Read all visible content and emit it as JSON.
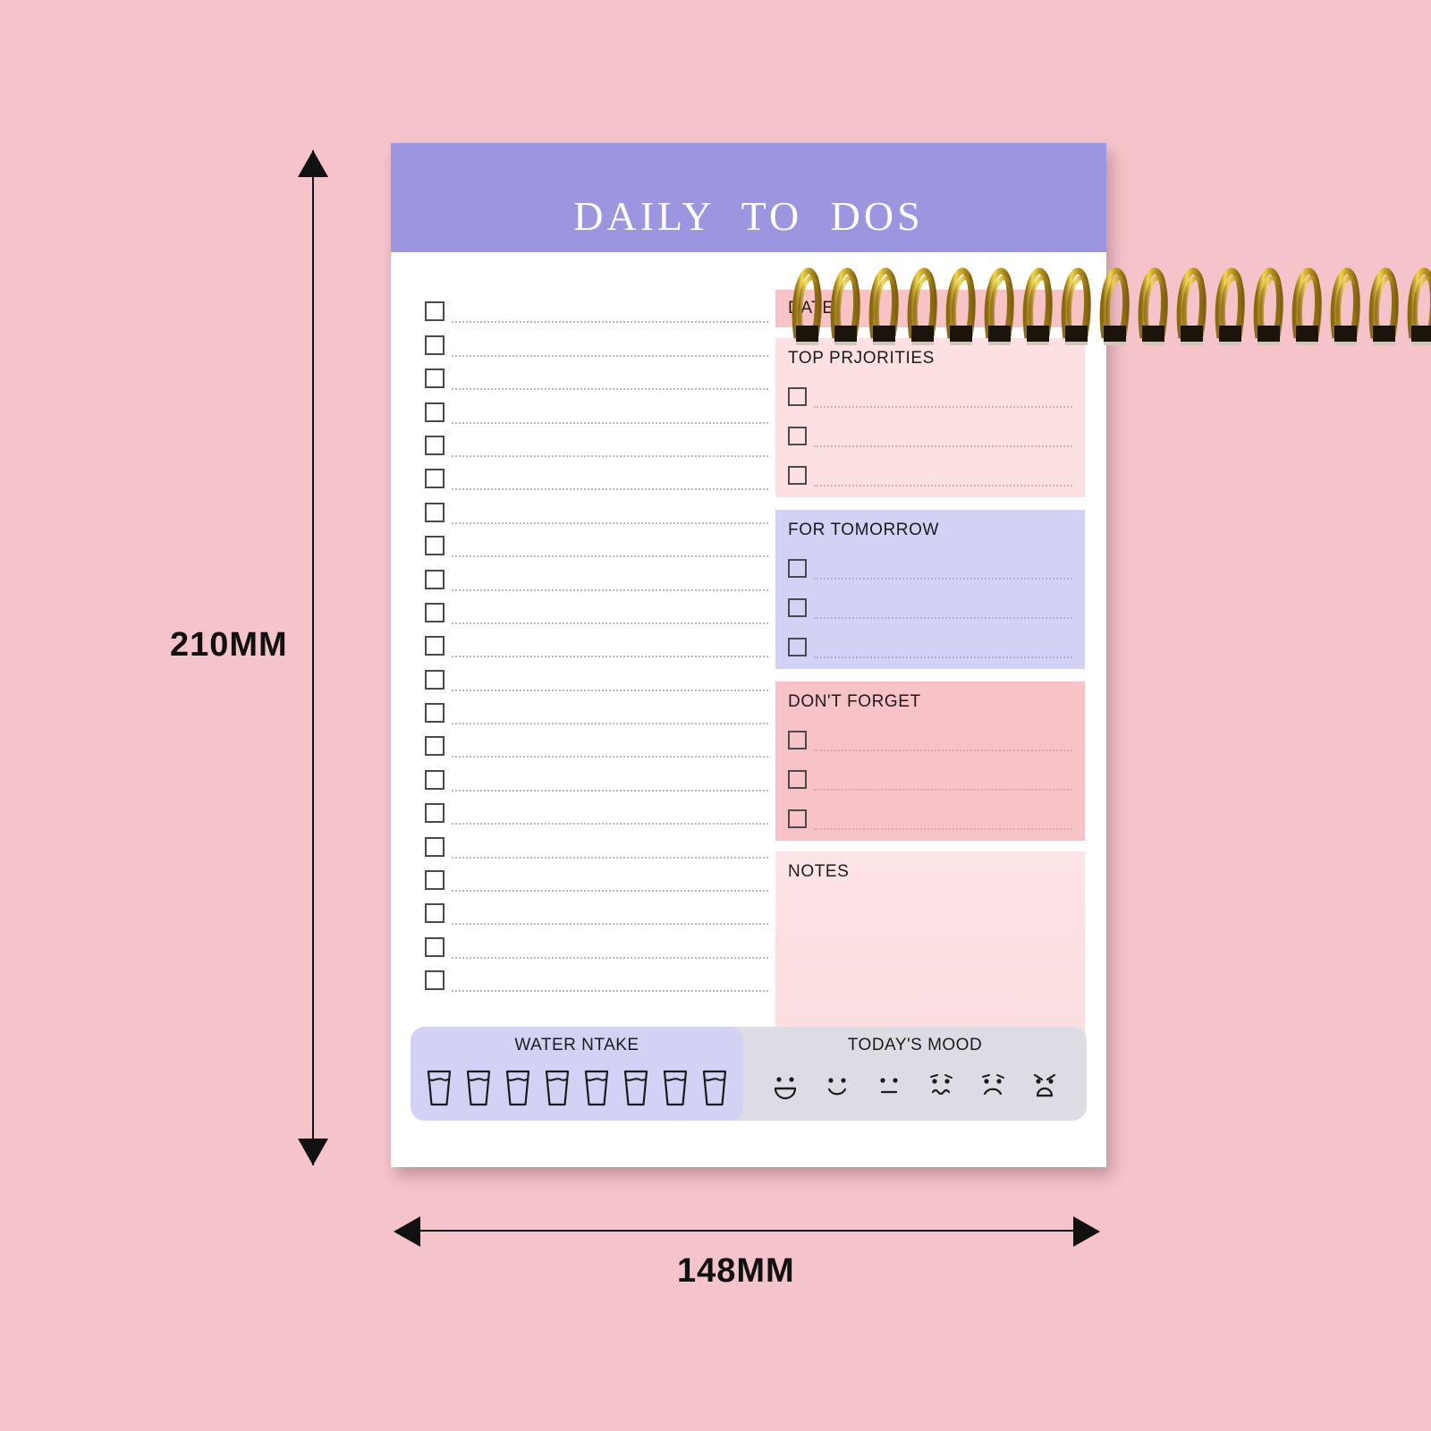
{
  "page": {
    "background_color": "#f5c3ca"
  },
  "dimensions": {
    "height_label": "210MM",
    "width_label": "148MM"
  },
  "notepad": {
    "title": "DAILY  TO  DOS",
    "header_color": "#9c95e0",
    "paper_color": "#ffffff",
    "spiral_color": "#c9a227",
    "task_list": {
      "row_count": 21,
      "checkbox_checked": false
    },
    "panels": [
      {
        "key": "date",
        "label": "DATE",
        "color": "#f8c3c6",
        "rows": 0
      },
      {
        "key": "top",
        "label": "TOP PRJORITIES",
        "color": "#fce0e2",
        "rows": 3
      },
      {
        "key": "tomorrow",
        "label": "FOR TOMORROW",
        "color": "#d3d2f4",
        "rows": 3
      },
      {
        "key": "forget",
        "label": "DON'T FORGET",
        "color": "#f8c3c6",
        "rows": 3
      },
      {
        "key": "notes",
        "label": "NOTES",
        "color": "#fde4e6",
        "rows": 0
      }
    ],
    "water": {
      "label": "WATER NTAKE",
      "color": "#d3d2f4",
      "glass_count": 8,
      "glasses_filled": 0
    },
    "mood": {
      "label": "TODAY'S MOOD",
      "color": "#dcdce4",
      "faces": [
        {
          "name": "grinning-face",
          "state": "very-happy"
        },
        {
          "name": "smiling-face",
          "state": "happy"
        },
        {
          "name": "neutral-face",
          "state": "neutral"
        },
        {
          "name": "worried-face",
          "state": "worried"
        },
        {
          "name": "sad-face",
          "state": "sad"
        },
        {
          "name": "angry-face",
          "state": "angry"
        }
      ]
    }
  }
}
